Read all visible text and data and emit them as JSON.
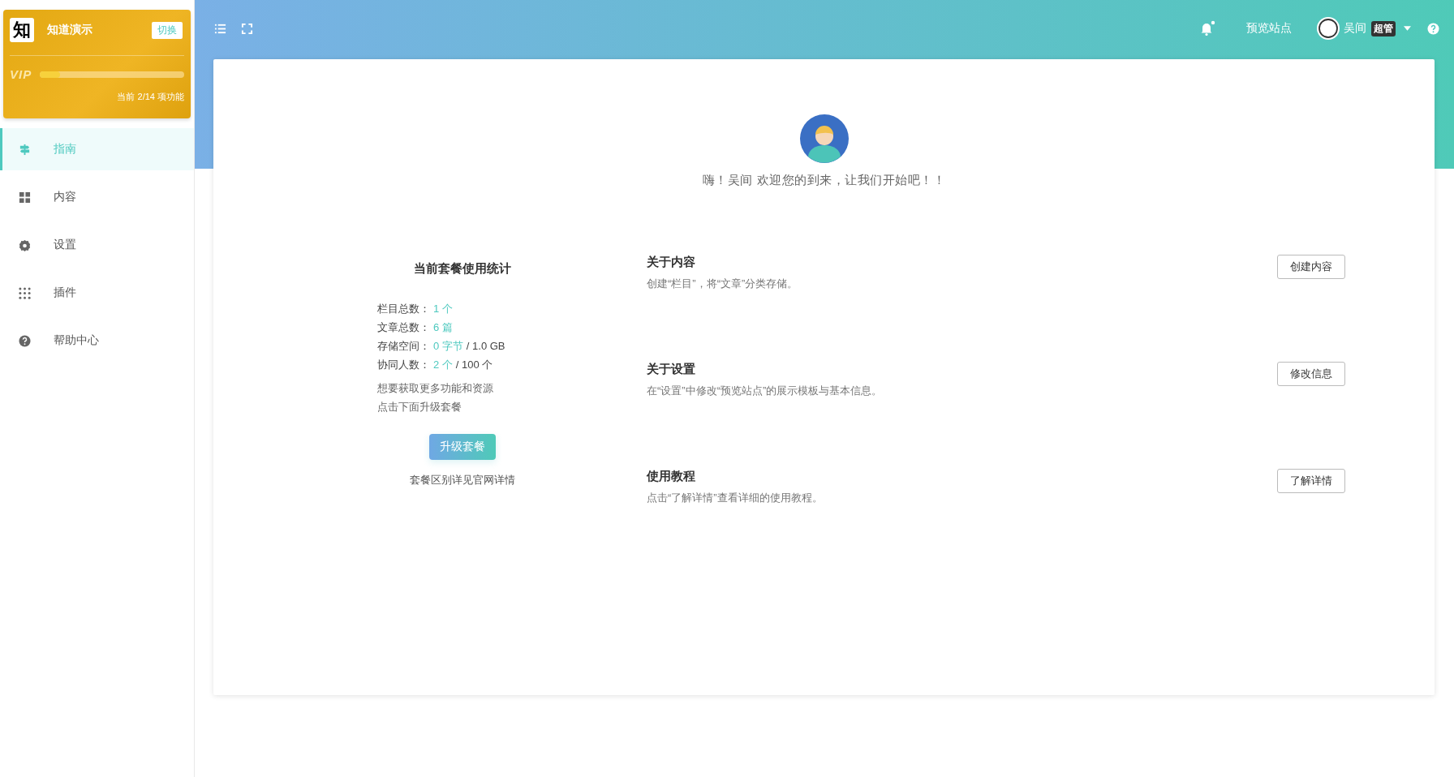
{
  "brand": {
    "logo_text": "知",
    "name": "知道演示",
    "switch_label": "切换",
    "vip_label": "VIP",
    "level": 0.14,
    "usage": "当前 2/14 项功能"
  },
  "sidebar": {
    "items": [
      {
        "label": "指南",
        "selected": true
      },
      {
        "label": "内容",
        "selected": false
      },
      {
        "label": "设置",
        "selected": false
      },
      {
        "label": "插件",
        "selected": false
      },
      {
        "label": "帮助中心",
        "selected": false
      }
    ]
  },
  "topbar": {
    "preview": "预览站点",
    "notification_dot": true,
    "user": "吴间",
    "role": "超管"
  },
  "welcome": "嗨！吴间 欢迎您的到来，让我们开始吧！！",
  "plan": {
    "title": "当前套餐使用统计",
    "stats": [
      {
        "label": "栏目总数：",
        "value": "1 个"
      },
      {
        "label": "文章总数：",
        "value": "6 篇"
      },
      {
        "label": "存储空间：",
        "value": "0 字节",
        "extra": "/ 1.0 GB"
      },
      {
        "label": "协同人数：",
        "value": "2 个",
        "extra": "/ 100 个"
      }
    ],
    "hint_lines": [
      "想要获取更多功能和资源",
      "点击下面升级套餐"
    ],
    "upgrade_button": "升级套餐",
    "footnote": "套餐区别详见官网详情"
  },
  "sections": [
    {
      "title": "关于内容",
      "description": "创建“栏目”，将“文章”分类存储。",
      "button": "创建内容"
    },
    {
      "title": "关于设置",
      "description": "在“设置”中修改“预览站点”的展示模板与基本信息。",
      "button": "修改信息"
    },
    {
      "title": "使用教程",
      "description": "点击“了解详情”查看详细的使用教程。",
      "button": "了解详情"
    }
  ]
}
